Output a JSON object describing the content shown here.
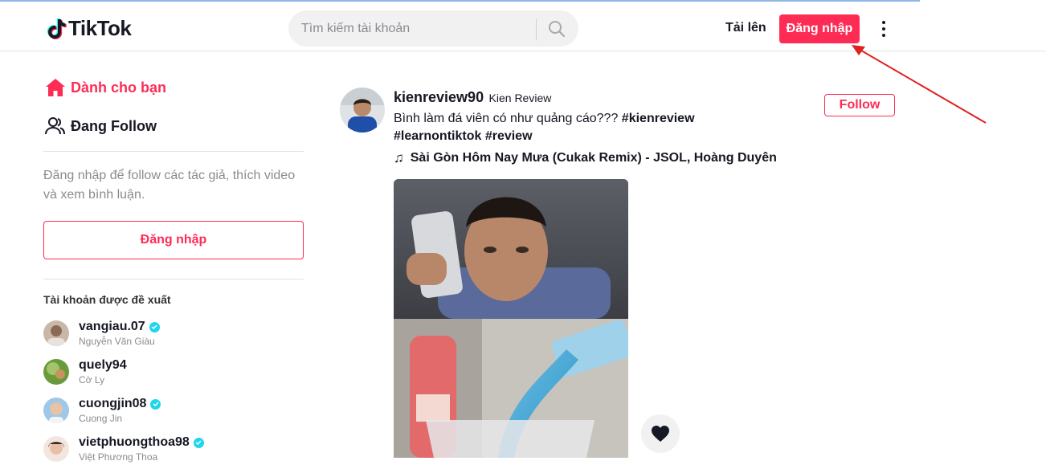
{
  "header": {
    "logo_text": "TikTok",
    "search_placeholder": "Tìm kiếm tài khoản",
    "upload_label": "Tải lên",
    "login_label": "Đăng nhập"
  },
  "sidebar": {
    "nav": [
      {
        "label": "Dành cho bạn",
        "icon": "home-icon",
        "active": true
      },
      {
        "label": "Đang Follow",
        "icon": "users-icon",
        "active": false
      }
    ],
    "login_hint": "Đăng nhập để follow các tác giả, thích video và xem bình luận.",
    "login_button": "Đăng nhập",
    "suggested_title": "Tài khoản được đề xuất",
    "accounts": [
      {
        "username": "vangiau.07",
        "nickname": "Nguyễn Văn Giàu",
        "verified": true
      },
      {
        "username": "quely94",
        "nickname": "Cờ Ly",
        "verified": false
      },
      {
        "username": "cuongjin08",
        "nickname": "Cuong Jin",
        "verified": true
      },
      {
        "username": "vietphuongthoa98",
        "nickname": "Việt Phương Thoa",
        "verified": true
      }
    ]
  },
  "post": {
    "username": "kienreview90",
    "nickname": "Kien Review",
    "caption_text": "Bình làm đá viên có như quảng cáo??? ",
    "hashtags": [
      "#kienreview",
      "#learnontiktok",
      "#review"
    ],
    "music": "Sài Gòn Hôm Nay Mưa (Cukak Remix) - JSOL, Hoàng Duyên",
    "follow_label": "Follow"
  },
  "colors": {
    "brand": "#fe2c55",
    "verified": "#20d5ec",
    "annotation_arrow": "#e02020"
  }
}
